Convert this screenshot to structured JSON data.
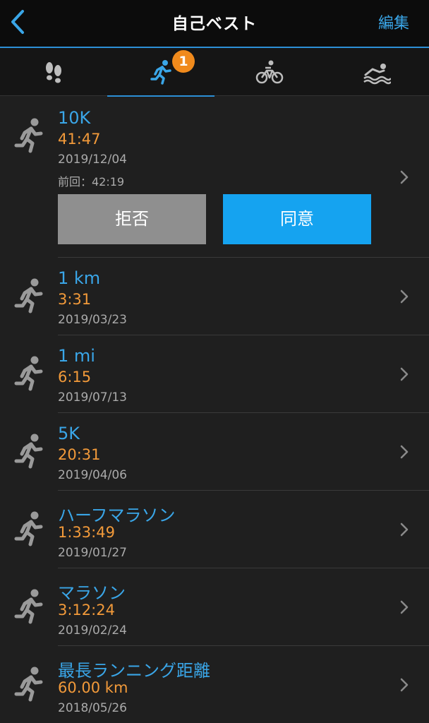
{
  "header": {
    "title": "自己ベスト",
    "edit_label": "編集"
  },
  "tabs": [
    {
      "name": "steps",
      "icon": "footsteps-icon",
      "active": false
    },
    {
      "name": "running",
      "icon": "running-icon",
      "active": true,
      "badge": "1"
    },
    {
      "name": "cycling",
      "icon": "bike-icon",
      "active": false
    },
    {
      "name": "swimming",
      "icon": "swim-icon",
      "active": false
    }
  ],
  "records": [
    {
      "label": "10K",
      "value": "41:47",
      "date": "2019/12/04",
      "previous": "前回：42:19",
      "pending": true,
      "reject_label": "拒否",
      "accept_label": "同意"
    },
    {
      "label": "1 km",
      "value": "3:31",
      "date": "2019/03/23"
    },
    {
      "label": "1 mi",
      "value": "6:15",
      "date": "2019/07/13"
    },
    {
      "label": "5K",
      "value": "20:31",
      "date": "2019/04/06"
    },
    {
      "label": "ハーフマラソン",
      "value": "1:33:49",
      "date": "2019/01/27"
    },
    {
      "label": "マラソン",
      "value": "3:12:24",
      "date": "2019/02/24"
    },
    {
      "label": "最長ランニング距離",
      "value": "60.00 km",
      "date": "2018/05/26"
    }
  ],
  "colors": {
    "accent": "#3aa6e8",
    "value": "#f29a3a",
    "badge": "#f08a1c",
    "accept": "#15a3f0",
    "reject": "#8f8f8f"
  }
}
